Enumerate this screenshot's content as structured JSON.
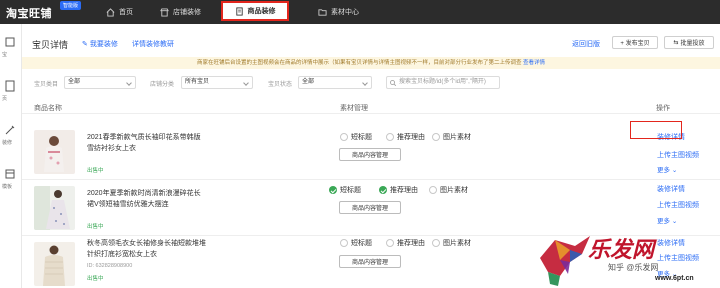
{
  "topbar": {
    "logo": "淘宝旺铺",
    "badge": "智能版",
    "nav": [
      {
        "label": "首页",
        "icon": "home-icon"
      },
      {
        "label": "店铺装修",
        "icon": "store-icon"
      },
      {
        "label": "商品装修",
        "icon": "document-icon",
        "active": true
      },
      {
        "label": "素材中心",
        "icon": "folder-icon"
      }
    ]
  },
  "rail": {
    "labels": [
      "宝",
      "页",
      "装修",
      "模板"
    ]
  },
  "header": {
    "title": "宝贝详情",
    "links": [
      "我要装修",
      "详情装修教研"
    ],
    "right_link": "返回旧版",
    "publish_button": "+ 发布宝贝",
    "batch_button": "批量投放"
  },
  "notice": {
    "text": "商家在旺铺后台设置的主图视频会在商品的详情中展示（如果有宝贝详情与详情主图视频不一样，目前对部分行业发布了第二上传调查",
    "link": "查看详情"
  },
  "filters": {
    "type_label": "宝贝类目",
    "type_value": "全部",
    "category_label": "店铺分类",
    "category_value": "所有宝贝",
    "status_label": "宝贝状态",
    "status_value": "全部",
    "search_placeholder": "搜索宝贝标题/id(多个id用\",\"隔开)"
  },
  "table": {
    "columns": [
      "商品名称",
      "素材管理",
      "操作"
    ],
    "material_options": [
      "短标题",
      "推荐理由",
      "图片素材"
    ],
    "manage_button": "商品内容管理",
    "rows": [
      {
        "title": "2021春季新款气质长袖印花系带韩版雪纺衬衫女上衣",
        "status": "出售中",
        "checks": [
          false,
          false,
          false
        ],
        "ops": [
          "装修详情",
          "上传主图视频",
          "更多"
        ]
      },
      {
        "title": "2020年夏季新款时尚清新浪漫碎花长裙V领短袖雪纺优雅大摆连",
        "status": "出售中",
        "checks": [
          true,
          true,
          false
        ],
        "ops": [
          "装修详情",
          "上传主图视频",
          "更多"
        ]
      },
      {
        "title": "秋冬高领毛衣女长袖修身长袖短款堆堆针织打底衫宽松女上衣",
        "id_text": "ID: 632828908900",
        "status": "出售中",
        "checks": [
          false,
          false,
          false
        ],
        "ops": [
          "装修详情",
          "上传主图视频",
          "更多"
        ]
      }
    ]
  },
  "watermark": {
    "brand": "乐发网",
    "sub": "知乎 @乐发网",
    "url": "www.6pt.cn"
  },
  "colors": {
    "accent": "#2b6cf5",
    "highlight": "#e3261d",
    "success": "#3aa856",
    "topbar": "#2c2c2c"
  }
}
